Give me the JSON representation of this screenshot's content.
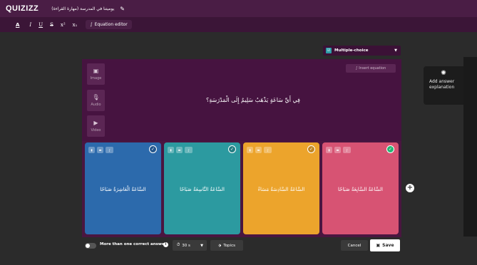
{
  "app": {
    "logo": "QUIZIZZ",
    "quiz_title": "يوميتنا في المدرسة (مهارة القراءة)"
  },
  "format_toolbar": {
    "text_color": "A",
    "italic": "I",
    "underline": "U",
    "strike": "S",
    "superscript": "x²",
    "subscript": "x₁",
    "equation_label": "Equation editor"
  },
  "question_type": {
    "label": "Multiple-choice"
  },
  "media": {
    "image": "Image",
    "audio": "Audio",
    "video": "Video"
  },
  "question": {
    "insert_equation": "Insert equation",
    "text": "فِي أَيِّ سَاعَةٍ يَذْهَبُ سَلِيمٌ إِلَى الْمَدْرَسَةِ؟"
  },
  "answers": [
    {
      "text": "السَّاعَةُ الْعَاشِرَةُ صَبَاحًا",
      "color": "#2c6aac",
      "correct": false
    },
    {
      "text": "السَّاعَةُ التَّاسِعَةُ صَبَاحًا",
      "color": "#2c9aa0",
      "correct": false
    },
    {
      "text": "السَّاعَةُ السَّادِسَةُ مَسَاءً",
      "color": "#eca42c",
      "correct": false
    },
    {
      "text": "السَّاعَةُ السَّابِعَةُ صَبَاحًا",
      "color": "#d75373",
      "correct": true
    }
  ],
  "side_panel": {
    "label_line1": "Add answer",
    "label_line2": "explanation"
  },
  "bottom_bar": {
    "multi_correct": "More than one correct answer",
    "time": "30 s",
    "topics": "Topics",
    "cancel": "Cancel",
    "save": "Save"
  }
}
